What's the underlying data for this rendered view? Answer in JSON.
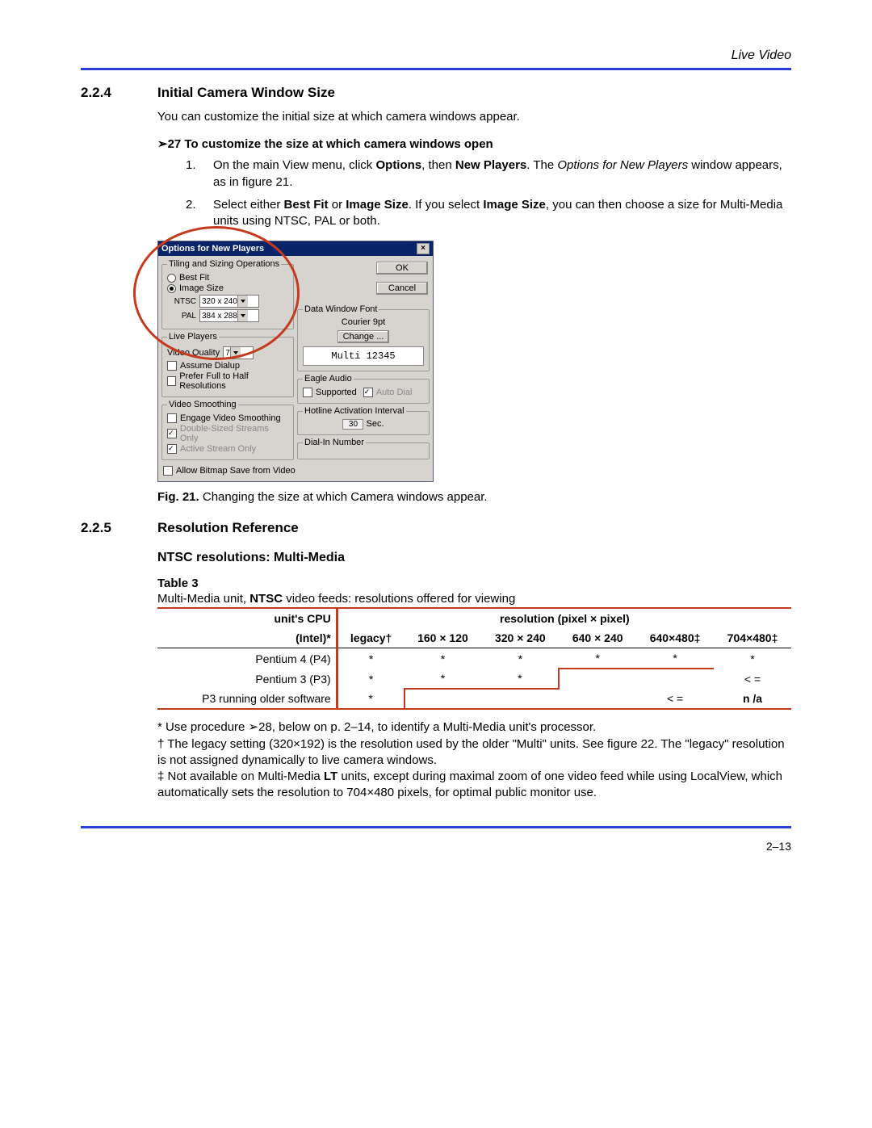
{
  "running_head": "Live Video",
  "section_224": {
    "num": "2.2.4",
    "title": "Initial Camera Window Size"
  },
  "intro_224": "You can customize the initial size at which camera windows appear.",
  "proc27_head": "➢27  To customize the size at which camera windows open",
  "step1": {
    "num": "1.",
    "text_a": "On the main View menu, click ",
    "b1": "Options",
    "text_b": ", then ",
    "b2": "New Players",
    "text_c": ". The ",
    "i1": "Options for New Players",
    "text_d": " window appears, as in figure 21."
  },
  "step2": {
    "num": "2.",
    "text_a": "Select either ",
    "b1": "Best Fit",
    "text_b": " or ",
    "b2": "Image Size",
    "text_c": ". If you select ",
    "b3": "Image Size",
    "text_d": ", you can then choose a size for Multi-Media units using NTSC, PAL or both."
  },
  "dialog": {
    "title": "Options for New Players",
    "close": "×",
    "tiling_legend": "Tiling and Sizing Operations",
    "best_fit": "Best Fit",
    "image_size": "Image Size",
    "ntsc_label": "NTSC",
    "ntsc_value": "320 x 240",
    "pal_label": "PAL",
    "pal_value": "384 x 288",
    "live_legend": "Live Players",
    "vq_label": "Video Quality",
    "vq_value": "7",
    "assume_dialup": "Assume Dialup",
    "prefer_full": "Prefer Full to Half Resolutions",
    "smooth_legend": "Video Smoothing",
    "engage_smooth": "Engage Video Smoothing",
    "double_sized": "Double-Sized Streams Only",
    "active_stream": "Active Stream Only",
    "allow_bitmap": "Allow Bitmap Save from Video",
    "ok": "OK",
    "cancel": "Cancel",
    "font_legend": "Data Window Font",
    "font_name": "Courier 9pt",
    "change": "Change ...",
    "font_sample": "Multi 12345",
    "eagle_legend": "Eagle Audio",
    "supported": "Supported",
    "auto_dial": "Auto Dial",
    "hotline_legend": "Hotline Activation Interval",
    "hotline_val": "30",
    "hotline_unit": "Sec.",
    "dialin_legend": "Dial-In Number"
  },
  "fig21": {
    "b": "Fig. 21.",
    "text": " Changing the size at which Camera windows appear."
  },
  "section_225": {
    "num": "2.2.5",
    "title": "Resolution Reference"
  },
  "ntsc_head": "NTSC resolutions: Multi-Media",
  "table3": {
    "label": "Table 3",
    "caption_a": "Multi-Media unit, ",
    "caption_b": "NTSC",
    "caption_c": " video feeds: resolutions offered for viewing",
    "head_left1": "unit's CPU",
    "head_left2": "(Intel)*",
    "head_right": "resolution (pixel × pixel)",
    "cols": [
      "legacy†",
      "160 × 120",
      "320 × 240",
      "640 × 240",
      "640×480‡",
      "704×480‡"
    ],
    "rows": [
      {
        "label": "Pentium 4 (P4)",
        "cells": [
          "*",
          "*",
          "*",
          "*",
          "*",
          "*"
        ]
      },
      {
        "label": "Pentium 3 (P3)",
        "cells": [
          "*",
          "*",
          "*",
          "",
          "",
          "< ="
        ]
      },
      {
        "label": "P3 running older software",
        "cells": [
          "*",
          "",
          "",
          "",
          "< =",
          "n /a"
        ]
      }
    ]
  },
  "notes": {
    "n1a": "* Use procedure ➢28, below on p. 2–14, to identify a Multi-Media unit's processor.",
    "n2a": "† The legacy setting (320×192) is the resolution used by the older \"Multi\" units. See figure 22. The \"legacy\" resolution is not assigned dynamically to live camera windows.",
    "n3a": "‡ Not available on Multi-Media ",
    "n3b": "LT",
    "n3c": " units, except during maximal zoom of one video feed while using LocalView, which automatically sets the resolution to 704×480 pixels, for optimal public monitor use."
  },
  "page_num": "2–13"
}
